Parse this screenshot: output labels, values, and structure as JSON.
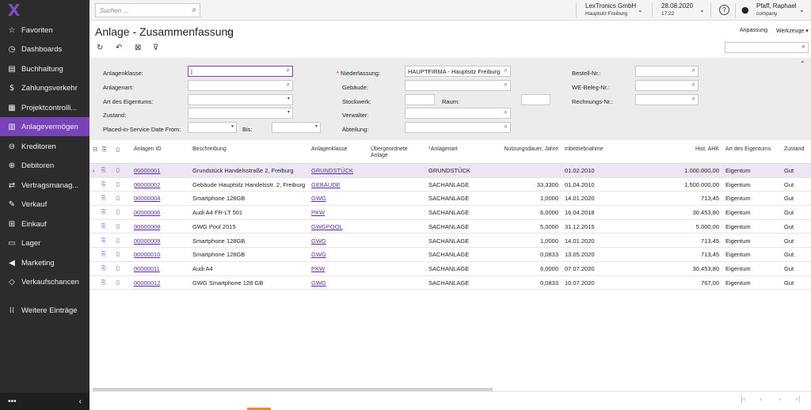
{
  "app": {
    "logo": "X",
    "search_placeholder": "Suchen ...",
    "company": "LexTronics GmbH",
    "branch": "Hauptsitz Freiburg",
    "date": "28.08.2020",
    "time": "17:22",
    "help": "?",
    "user_name": "Pfaff, Raphael",
    "user_company": "company"
  },
  "sidebar": {
    "items": [
      {
        "label": "Favoriten",
        "icon": "☆"
      },
      {
        "label": "Dashboards",
        "icon": "◷"
      },
      {
        "label": "Buchhaltung",
        "icon": "▤"
      },
      {
        "label": "Zahlungsverkehr",
        "icon": "$"
      },
      {
        "label": "Projektcontrolli...",
        "icon": "▦"
      },
      {
        "label": "Anlagevermögen",
        "icon": "▥"
      },
      {
        "label": "Kreditoren",
        "icon": "⊖"
      },
      {
        "label": "Debitoren",
        "icon": "⊕"
      },
      {
        "label": "Vertragsmanag...",
        "icon": "⇄"
      },
      {
        "label": "Verkauf",
        "icon": "✎"
      },
      {
        "label": "Einkauf",
        "icon": "⊞"
      },
      {
        "label": "Lager",
        "icon": "▭"
      },
      {
        "label": "Marketing",
        "icon": "◀"
      },
      {
        "label": "Verkaufschancen",
        "icon": "◇"
      },
      {
        "label": "Weitere Einträge",
        "icon": "⁞⁞"
      }
    ],
    "more": "•••",
    "collapse": "‹"
  },
  "page": {
    "title": "Anlage - Zusammenfassung",
    "star": "☆",
    "anpassung": "Anpassung",
    "werkzeuge": "Werkzeuge ▾"
  },
  "filters": {
    "anlagenklasse_label": "Anlagenklasse:",
    "anlagenart_label": "Anlagenart:",
    "eigentum_label": "Art des Eigentums:",
    "zustand_label": "Zustand:",
    "placed_label": "Placed-in-Service Date From:",
    "bis_label": "Bis:",
    "niederlassung_label": "Niederlassung:",
    "niederlassung_value": "HAUPTFIRMA - Hauptsitz Freiburg",
    "gebaeude_label": "Gebäude:",
    "stockwerk_label": "Stockwerk:",
    "raum_label": "Raum:",
    "verwalter_label": "Verwalter:",
    "abteilung_label": "Abteilung:",
    "bestell_label": "Bestell-Nr.:",
    "webeleg_label": "WE-Beleg-Nr.:",
    "rechnungs_label": "Rechnungs-Nr.:"
  },
  "table": {
    "headers": {
      "anlagen_id": "Anlagen ID",
      "beschreibung": "Beschreibung",
      "anlagenklasse": "Anlagenklasse",
      "uebergeordnete": "Übergeordnete Anlage",
      "anlagenart": "Anlagenart",
      "nutzungsdauer": "Nutzungsdauer, Jahre",
      "inbetriebnahme": "Inbetriebnahme",
      "hist_ahk": "Hist. AHK",
      "eigentum": "Art des Eigentums",
      "zustand": "Zustand"
    },
    "rows": [
      {
        "id": "00000001",
        "desc": "Grundstück Handelsstraße 2, Freiburg",
        "klasse": "GRUNDSTÜCK",
        "art": "GRUNDSTÜCK",
        "dauer": "",
        "datum": "01.02.2010",
        "ahk": "1.000.000,00",
        "eigentum": "Eigentum",
        "zustand": "Gut"
      },
      {
        "id": "00000002",
        "desc": "Gebäude Hauptsitz Handelsstr. 2, Freiburg",
        "klasse": "GEBÄUDE",
        "art": "SACHANLAGE",
        "dauer": "33,3300",
        "datum": "01.04.2010",
        "ahk": "1.500.000,00",
        "eigentum": "Eigentum",
        "zustand": "Gut"
      },
      {
        "id": "00000004",
        "desc": "Smartphone 128GB",
        "klasse": "GWG",
        "art": "SACHANLAGE",
        "dauer": "1,0000",
        "datum": "14.01.2020",
        "ahk": "713,45",
        "eigentum": "Eigentum",
        "zustand": "Gut"
      },
      {
        "id": "00000006",
        "desc": "Audi A4 FR-LT 501",
        "klasse": "PKW",
        "art": "SACHANLAGE",
        "dauer": "6,0000",
        "datum": "16.04.2018",
        "ahk": "30.453,80",
        "eigentum": "Eigentum",
        "zustand": "Gut"
      },
      {
        "id": "00000008",
        "desc": "GWG Pool 2015",
        "klasse": "GWGPOOL",
        "art": "SACHANLAGE",
        "dauer": "5,0000",
        "datum": "31.12.2015",
        "ahk": "5.000,00",
        "eigentum": "Eigentum",
        "zustand": "Gut"
      },
      {
        "id": "00000009",
        "desc": "Smartphone 128GB",
        "klasse": "GWG",
        "art": "SACHANLAGE",
        "dauer": "1,0000",
        "datum": "14.01.2020",
        "ahk": "713,45",
        "eigentum": "Eigentum",
        "zustand": "Gut"
      },
      {
        "id": "00000010",
        "desc": "Smartphone 128GB",
        "klasse": "GWG",
        "art": "SACHANLAGE",
        "dauer": "0,0833",
        "datum": "13.05.2020",
        "ahk": "713,45",
        "eigentum": "Eigentum",
        "zustand": "Gut"
      },
      {
        "id": "00000011",
        "desc": "Audi A4",
        "klasse": "PKW",
        "art": "SACHANLAGE",
        "dauer": "6,0000",
        "datum": "07.07.2020",
        "ahk": "30.453,80",
        "eigentum": "Eigentum",
        "zustand": "Gut"
      },
      {
        "id": "00000012",
        "desc": "GWG Smartphone 128 GB",
        "klasse": "GWG",
        "art": "SACHANLAGE",
        "dauer": "0,0833",
        "datum": "10.07.2020",
        "ahk": "767,00",
        "eigentum": "Eigentum",
        "zustand": "Gut"
      }
    ]
  },
  "pager": [
    "|‹",
    "‹",
    "›",
    "›|"
  ]
}
